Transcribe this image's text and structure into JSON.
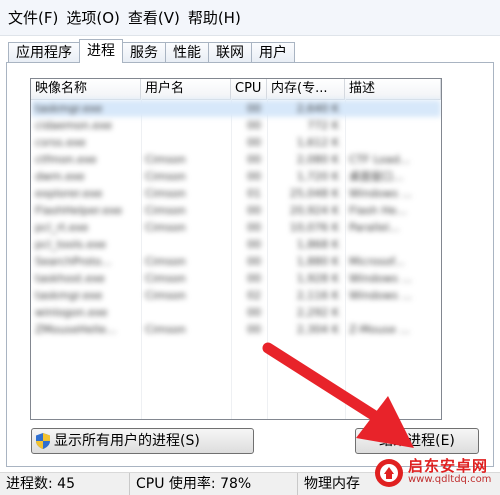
{
  "menu": [
    "文件(F)",
    "选项(O)",
    "查看(V)",
    "帮助(H)"
  ],
  "tabs": [
    "应用程序",
    "进程",
    "服务",
    "性能",
    "联网",
    "用户"
  ],
  "active_tab": "进程",
  "columns": [
    "映像名称",
    "用户名",
    "CPU",
    "内存(专...",
    "描述"
  ],
  "rows": [
    [
      "taskmgr.exe",
      "",
      "00",
      "2,640 K",
      ""
    ],
    [
      "cidaemon.exe",
      "",
      "00",
      "772 K",
      ""
    ],
    [
      "csrss.exe",
      "",
      "00",
      "1,612 K",
      ""
    ],
    [
      "ctfmon.exe",
      "Cimson",
      "00",
      "2,080 K",
      "CTF Load..."
    ],
    [
      "dwm.exe",
      "Cimson",
      "00",
      "1,720 K",
      "桌面窗口..."
    ],
    [
      "explorer.exe",
      "Cimson",
      "01",
      "25,048 K",
      "Windows ..."
    ],
    [
      "FlashHelper.exe",
      "Cimson",
      "00",
      "20,924 K",
      "Flash He..."
    ],
    [
      "pcl_rt.exe",
      "Cimson",
      "00",
      "10,076 K",
      "Parallel..."
    ],
    [
      "pcl_tools.exe",
      "",
      "00",
      "1,868 K",
      ""
    ],
    [
      "SearchProto...",
      "Cimson",
      "00",
      "1,880 K",
      "Microsof..."
    ],
    [
      "taskhost.exe",
      "Cimson",
      "00",
      "1,928 K",
      "Windows ..."
    ],
    [
      "taskmgr.exe",
      "Cimson",
      "02",
      "2,116 K",
      "Windows ..."
    ],
    [
      "winlogon.exe",
      "",
      "00",
      "2,292 K",
      ""
    ],
    [
      "ZMouseHelle...",
      "Cimson",
      "00",
      "2,304 K",
      "Z-Mouse ..."
    ]
  ],
  "buttons": {
    "show_all": "显示所有用户的进程(S)",
    "end_process": "结束进程(E)"
  },
  "status": {
    "processes": "进程数: 45",
    "cpu": "CPU 使用率: 78%",
    "memory": "物理内存"
  },
  "watermark": {
    "title": "启东安卓网",
    "url": "www.qdltdq.com"
  },
  "colors": {
    "arrow": "#e8232a",
    "selection": "#d7e8fa"
  },
  "icons": [
    "uac-shield-icon",
    "red-arrow-annotation",
    "watermark-logo-icon"
  ]
}
